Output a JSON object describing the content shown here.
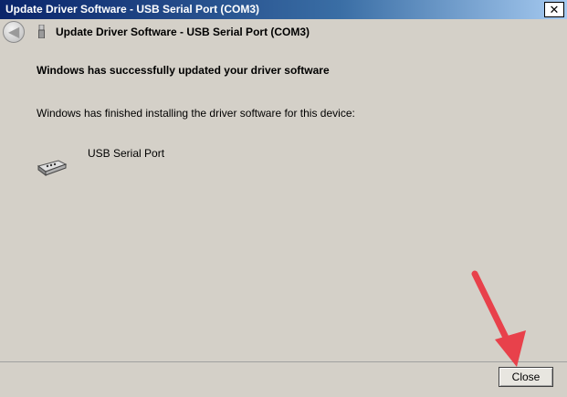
{
  "window": {
    "title": "Update Driver Software - USB Serial Port (COM3)",
    "close_glyph": "✕"
  },
  "header": {
    "back_icon": "back-arrow-icon",
    "device_icon": "usb-icon",
    "title": "Update Driver Software - USB Serial Port (COM3)"
  },
  "content": {
    "headline": "Windows has successfully updated your driver software",
    "subtext": "Windows has finished installing the driver software for this device:",
    "device_name": "USB Serial Port",
    "device_icon": "serial-port-icon"
  },
  "footer": {
    "close_label": "Close"
  },
  "annotation": {
    "arrow_color": "#e8414b"
  }
}
